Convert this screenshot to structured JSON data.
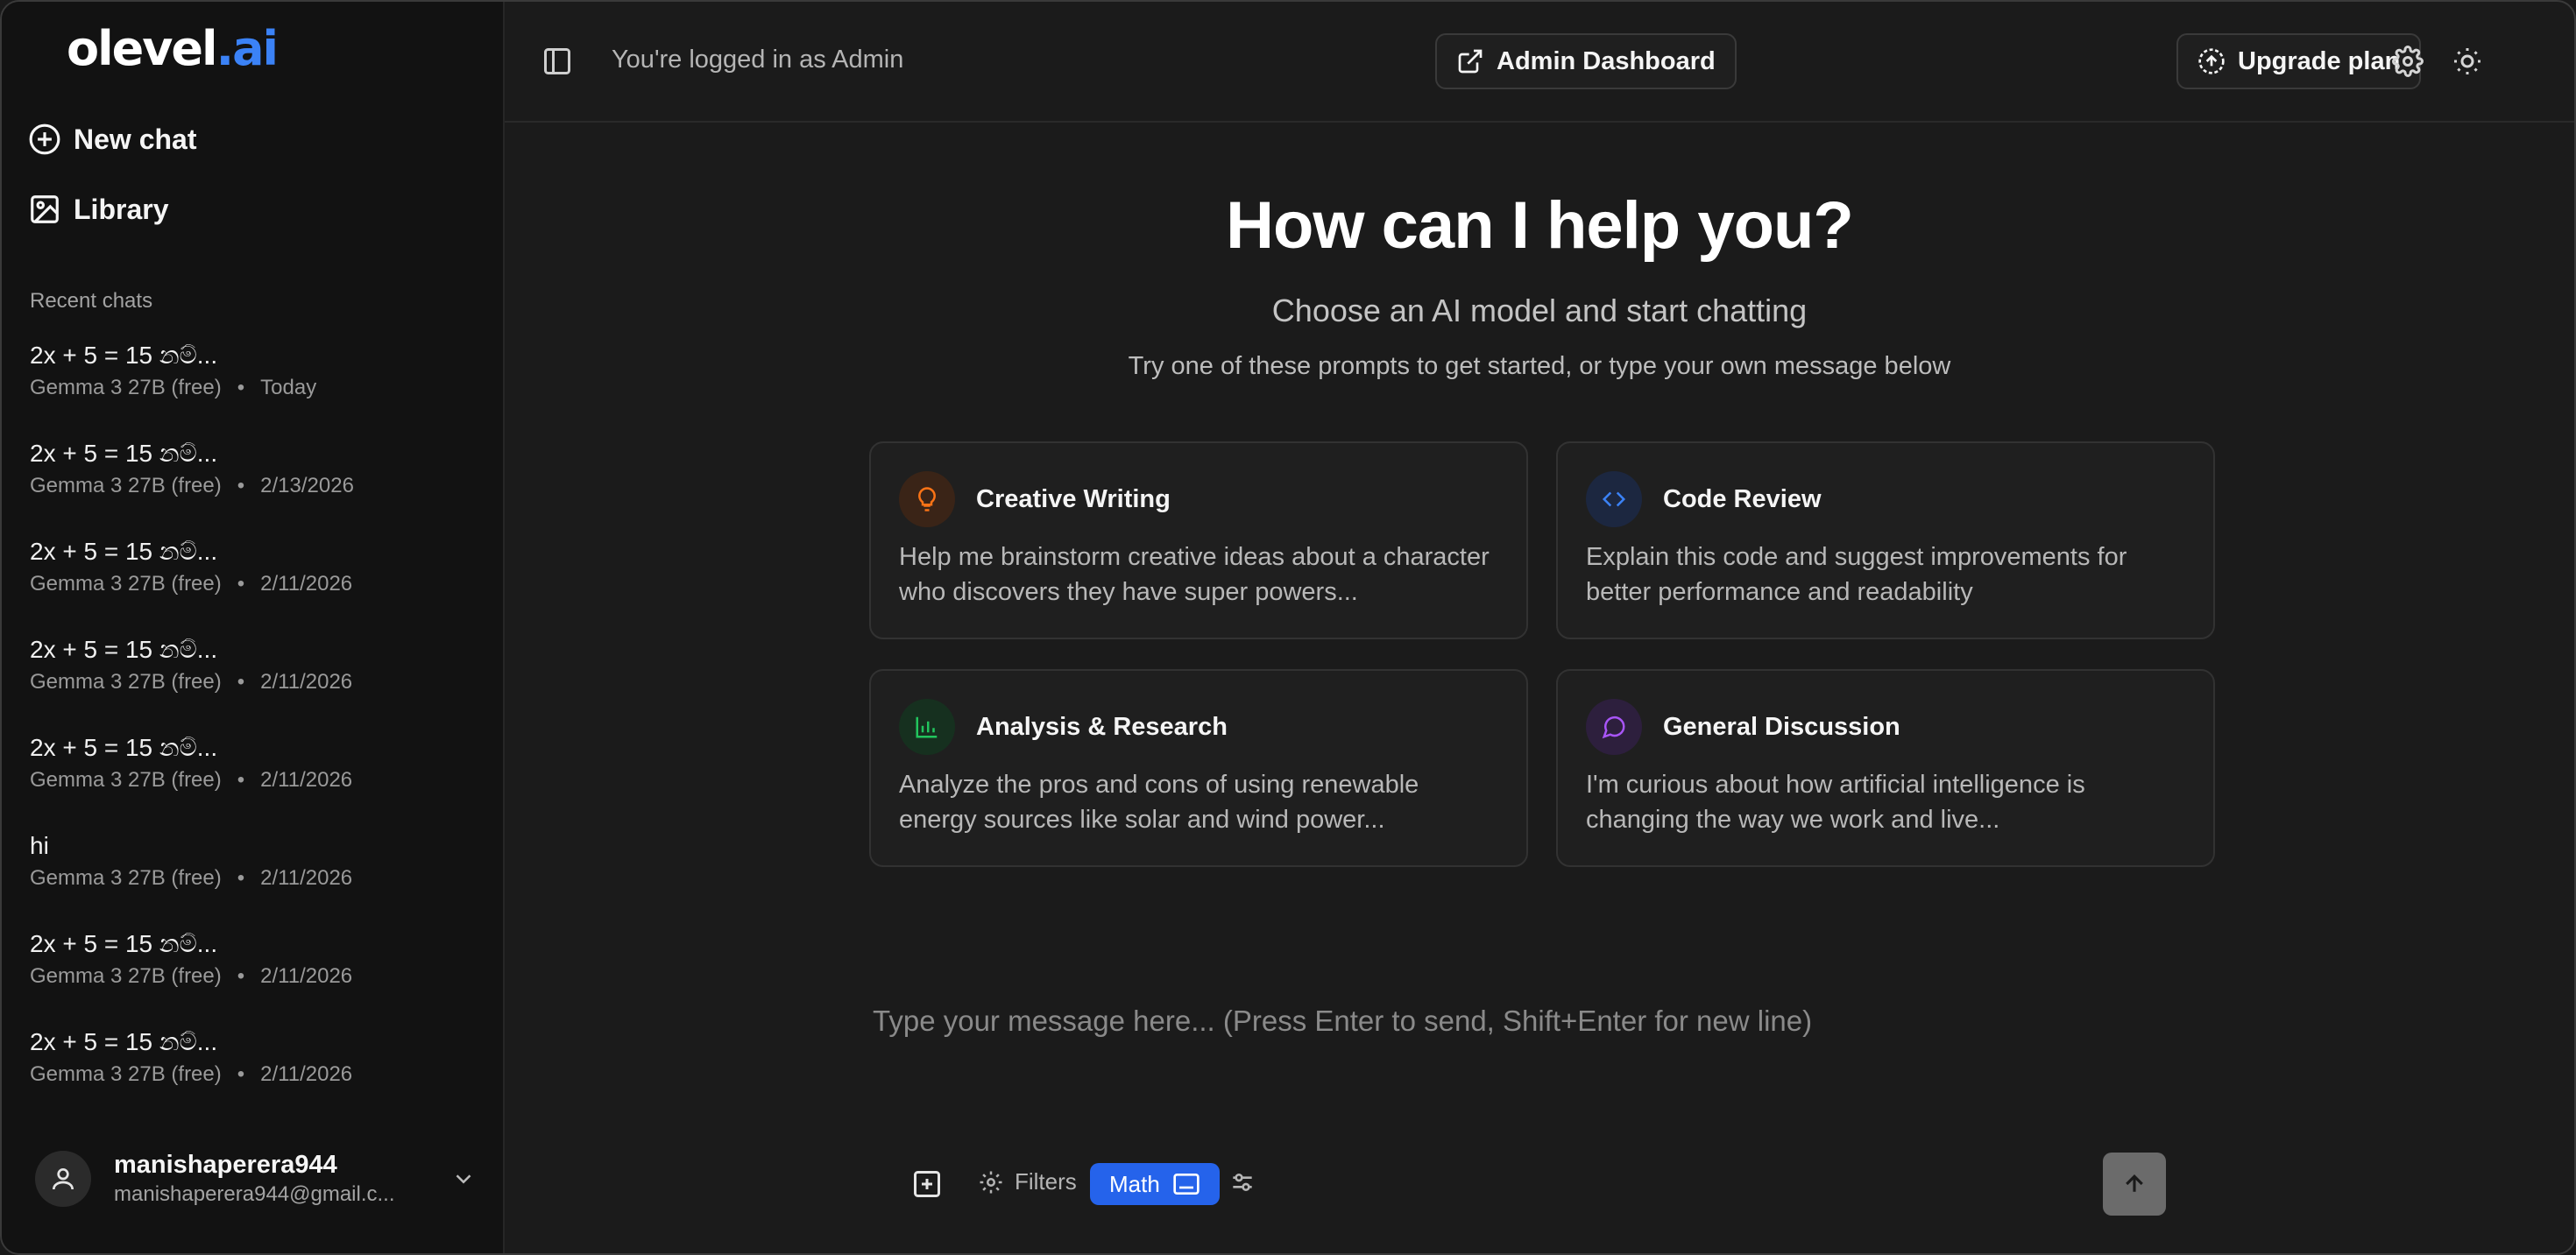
{
  "sidebar": {
    "logo_main": "olevel",
    "logo_dot_ai": ".ai",
    "new_chat": "New chat",
    "library": "Library",
    "recent_heading": "Recent chats",
    "chats": [
      {
        "title": "2x + 5 = 15 නම්...",
        "model": "Gemma 3 27B (free)",
        "date": "Today"
      },
      {
        "title": "2x + 5 = 15 නම්...",
        "model": "Gemma 3 27B (free)",
        "date": "2/13/2026"
      },
      {
        "title": "2x + 5 = 15 නම්...",
        "model": "Gemma 3 27B (free)",
        "date": "2/11/2026"
      },
      {
        "title": "2x + 5 = 15 නම්...",
        "model": "Gemma 3 27B (free)",
        "date": "2/11/2026"
      },
      {
        "title": "2x + 5 = 15 නම්...",
        "model": "Gemma 3 27B (free)",
        "date": "2/11/2026"
      },
      {
        "title": "hi",
        "model": "Gemma 3 27B (free)",
        "date": "2/11/2026"
      },
      {
        "title": "2x + 5 = 15 නම්...",
        "model": "Gemma 3 27B (free)",
        "date": "2/11/2026"
      },
      {
        "title": "2x + 5 = 15 නම්...",
        "model": "Gemma 3 27B (free)",
        "date": "2/11/2026"
      }
    ],
    "meta_separator": "•",
    "user": {
      "name": "manishaperera944",
      "email": "manishaperera944@gmail.c..."
    }
  },
  "topbar": {
    "logged_in_text": "You're logged in as Admin",
    "admin_dashboard": "Admin Dashboard",
    "upgrade_plan": "Upgrade plan"
  },
  "hero": {
    "title": "How can I help you?",
    "subtitle": "Choose an AI model and start chatting",
    "hint": "Try one of these prompts to get started, or type your own message below"
  },
  "cards": [
    {
      "title": "Creative Writing",
      "desc": "Help me brainstorm creative ideas about a character who discovers they have super powers...",
      "icon": "lightbulb-icon",
      "color": "#f97316"
    },
    {
      "title": "Code Review",
      "desc": "Explain this code and suggest improvements for better performance and readability",
      "icon": "code-icon",
      "color": "#3b82f6"
    },
    {
      "title": "Analysis & Research",
      "desc": "Analyze the pros and cons of using renewable energy sources like solar and wind power...",
      "icon": "bar-chart-icon",
      "color": "#22c55e"
    },
    {
      "title": "General Discussion",
      "desc": "I'm curious about how artificial intelligence is changing the way we work and live...",
      "icon": "message-circle-icon",
      "color": "#a855f7"
    }
  ],
  "composer": {
    "placeholder": "Type your message here... (Press Enter to send, Shift+Enter for new line)",
    "filters": "Filters",
    "math": "Math"
  },
  "colors": {
    "accent": "#2563eb",
    "background": "#1b1b1b",
    "sidebar": "#121212"
  }
}
